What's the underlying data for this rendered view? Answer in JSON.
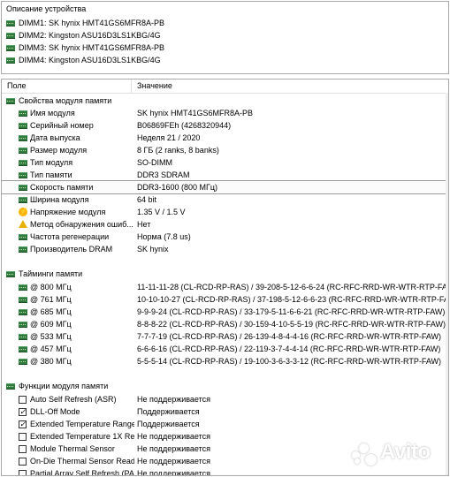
{
  "top_pane": {
    "title": "Описание устройства",
    "devices": [
      "DIMM1: SK hynix HMT41GS6MFR8A-PB",
      "DIMM2: Kingston ASU16D3LS1KBG/4G",
      "DIMM3: SK hynix HMT41GS6MFR8A-PB",
      "DIMM4: Kingston ASU16D3LS1KBG/4G"
    ]
  },
  "columns": {
    "field": "Поле",
    "value": "Значение"
  },
  "module_props": {
    "title": "Свойства модуля памяти",
    "rows": [
      {
        "name": "Имя модуля",
        "value": "SK hynix HMT41GS6MFR8A-PB",
        "icon": "memory-icon"
      },
      {
        "name": "Серийный номер",
        "value": "B06869FEh (4268320944)",
        "icon": "memory-icon"
      },
      {
        "name": "Дата выпуска",
        "value": "Неделя 21 / 2020",
        "icon": "memory-icon"
      },
      {
        "name": "Размер модуля",
        "value": "8 ГБ (2 ranks, 8 banks)",
        "icon": "memory-icon"
      },
      {
        "name": "Тип модуля",
        "value": "SO-DIMM",
        "icon": "memory-icon"
      },
      {
        "name": "Тип памяти",
        "value": "DDR3 SDRAM",
        "icon": "memory-icon"
      },
      {
        "name": "Скорость памяти",
        "value": "DDR3-1600 (800 МГц)",
        "icon": "memory-icon"
      },
      {
        "name": "Ширина модуля",
        "value": "64 bit",
        "icon": "memory-icon"
      },
      {
        "name": "Напряжение модуля",
        "value": "1.35 V / 1.5 V",
        "icon": "voltage-icon"
      },
      {
        "name": "Метод обнаружения ошиб...",
        "value": "Нет",
        "icon": "warning-icon"
      },
      {
        "name": "Частота регенерации",
        "value": "Норма (7.8 us)",
        "icon": "memory-icon"
      },
      {
        "name": "Производитель DRAM",
        "value": "SK hynix",
        "icon": "memory-icon"
      }
    ]
  },
  "timings": {
    "title": "Тайминги памяти",
    "rows": [
      {
        "name": "@ 800 МГц",
        "value": "11-11-11-28  (CL-RCD-RP-RAS) / 39-208-5-12-6-6-24  (RC-RFC-RRD-WR-WTR-RTP-FAW)"
      },
      {
        "name": "@ 761 МГц",
        "value": "10-10-10-27  (CL-RCD-RP-RAS) / 37-198-5-12-6-6-23  (RC-RFC-RRD-WR-WTR-RTP-FAW)"
      },
      {
        "name": "@ 685 МГц",
        "value": "9-9-9-24  (CL-RCD-RP-RAS) / 33-179-5-11-6-6-21  (RC-RFC-RRD-WR-WTR-RTP-FAW)"
      },
      {
        "name": "@ 609 МГц",
        "value": "8-8-8-22  (CL-RCD-RP-RAS) / 30-159-4-10-5-5-19  (RC-RFC-RRD-WR-WTR-RTP-FAW)"
      },
      {
        "name": "@ 533 МГц",
        "value": "7-7-7-19  (CL-RCD-RP-RAS) / 26-139-4-8-4-4-16  (RC-RFC-RRD-WR-WTR-RTP-FAW)"
      },
      {
        "name": "@ 457 МГц",
        "value": "6-6-6-16  (CL-RCD-RP-RAS) / 22-119-3-7-4-4-14  (RC-RFC-RRD-WR-WTR-RTP-FAW)"
      },
      {
        "name": "@ 380 МГц",
        "value": "5-5-5-14  (CL-RCD-RP-RAS) / 19-100-3-6-3-3-12  (RC-RFC-RRD-WR-WTR-RTP-FAW)"
      }
    ]
  },
  "functions": {
    "title": "Функции модуля памяти",
    "rows": [
      {
        "name": "Auto Self Refresh (ASR)",
        "value": "Не поддерживается",
        "checked": false
      },
      {
        "name": "DLL-Off Mode",
        "value": "Поддерживается",
        "checked": true
      },
      {
        "name": "Extended Temperature Range",
        "value": "Поддерживается",
        "checked": true
      },
      {
        "name": "Extended Temperature 1X Re...",
        "value": "Не поддерживается",
        "checked": false
      },
      {
        "name": "Module Thermal Sensor",
        "value": "Не поддерживается",
        "checked": false
      },
      {
        "name": "On-Die Thermal Sensor Read...",
        "value": "Не поддерживается",
        "checked": false
      },
      {
        "name": "Partial Array Self Refresh (PA...",
        "value": "Не поддерживается",
        "checked": false
      }
    ]
  },
  "watermark": {
    "text": "Avito"
  },
  "colors": {
    "ram_icon": "#2f7a3d",
    "border": "#a9a9a9",
    "selection": "#9a9a9a"
  }
}
